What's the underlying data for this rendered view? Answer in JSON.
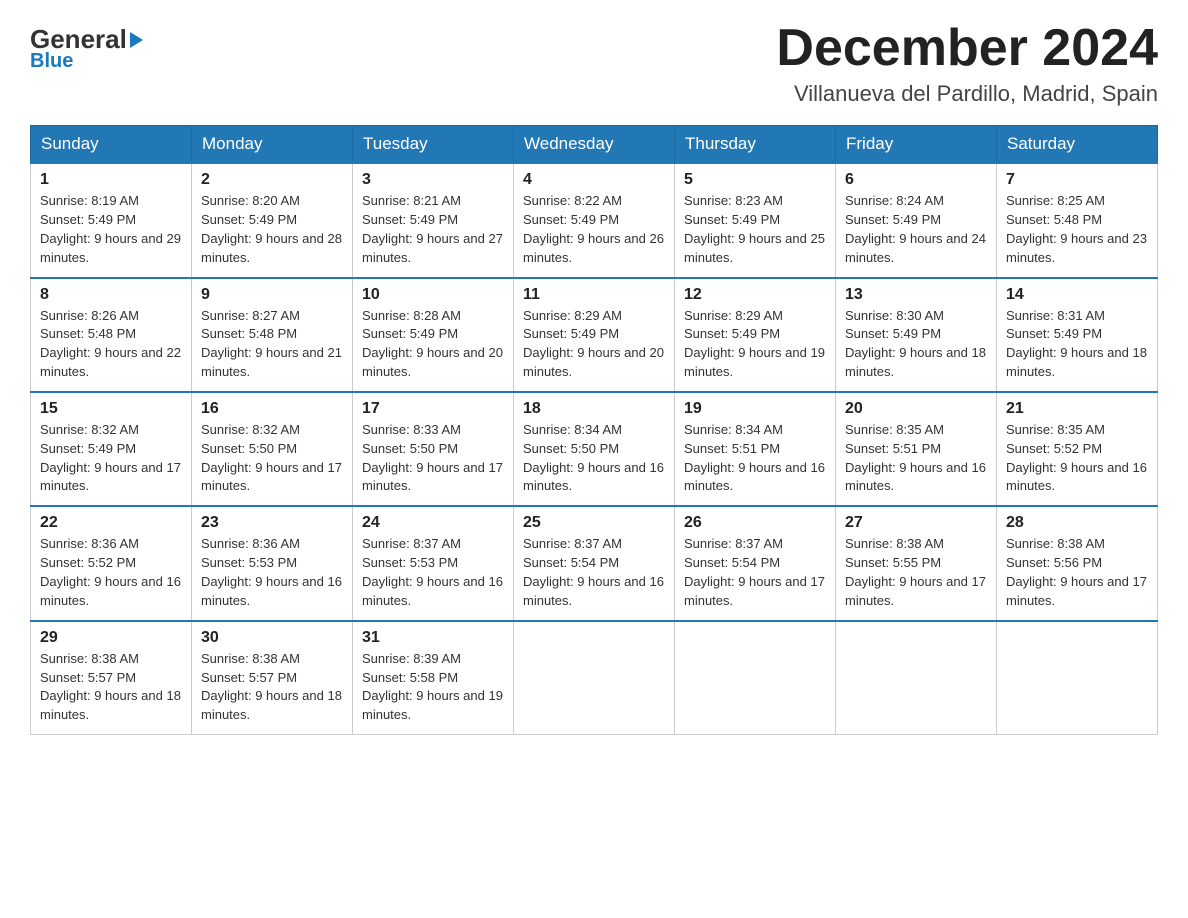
{
  "header": {
    "logo_general": "General",
    "logo_triangle": "▶",
    "logo_blue": "Blue",
    "month_title": "December 2024",
    "location": "Villanueva del Pardillo, Madrid, Spain"
  },
  "weekdays": [
    "Sunday",
    "Monday",
    "Tuesday",
    "Wednesday",
    "Thursday",
    "Friday",
    "Saturday"
  ],
  "weeks": [
    [
      {
        "day": "1",
        "sunrise": "8:19 AM",
        "sunset": "5:49 PM",
        "daylight": "9 hours and 29 minutes."
      },
      {
        "day": "2",
        "sunrise": "8:20 AM",
        "sunset": "5:49 PM",
        "daylight": "9 hours and 28 minutes."
      },
      {
        "day": "3",
        "sunrise": "8:21 AM",
        "sunset": "5:49 PM",
        "daylight": "9 hours and 27 minutes."
      },
      {
        "day": "4",
        "sunrise": "8:22 AM",
        "sunset": "5:49 PM",
        "daylight": "9 hours and 26 minutes."
      },
      {
        "day": "5",
        "sunrise": "8:23 AM",
        "sunset": "5:49 PM",
        "daylight": "9 hours and 25 minutes."
      },
      {
        "day": "6",
        "sunrise": "8:24 AM",
        "sunset": "5:49 PM",
        "daylight": "9 hours and 24 minutes."
      },
      {
        "day": "7",
        "sunrise": "8:25 AM",
        "sunset": "5:48 PM",
        "daylight": "9 hours and 23 minutes."
      }
    ],
    [
      {
        "day": "8",
        "sunrise": "8:26 AM",
        "sunset": "5:48 PM",
        "daylight": "9 hours and 22 minutes."
      },
      {
        "day": "9",
        "sunrise": "8:27 AM",
        "sunset": "5:48 PM",
        "daylight": "9 hours and 21 minutes."
      },
      {
        "day": "10",
        "sunrise": "8:28 AM",
        "sunset": "5:49 PM",
        "daylight": "9 hours and 20 minutes."
      },
      {
        "day": "11",
        "sunrise": "8:29 AM",
        "sunset": "5:49 PM",
        "daylight": "9 hours and 20 minutes."
      },
      {
        "day": "12",
        "sunrise": "8:29 AM",
        "sunset": "5:49 PM",
        "daylight": "9 hours and 19 minutes."
      },
      {
        "day": "13",
        "sunrise": "8:30 AM",
        "sunset": "5:49 PM",
        "daylight": "9 hours and 18 minutes."
      },
      {
        "day": "14",
        "sunrise": "8:31 AM",
        "sunset": "5:49 PM",
        "daylight": "9 hours and 18 minutes."
      }
    ],
    [
      {
        "day": "15",
        "sunrise": "8:32 AM",
        "sunset": "5:49 PM",
        "daylight": "9 hours and 17 minutes."
      },
      {
        "day": "16",
        "sunrise": "8:32 AM",
        "sunset": "5:50 PM",
        "daylight": "9 hours and 17 minutes."
      },
      {
        "day": "17",
        "sunrise": "8:33 AM",
        "sunset": "5:50 PM",
        "daylight": "9 hours and 17 minutes."
      },
      {
        "day": "18",
        "sunrise": "8:34 AM",
        "sunset": "5:50 PM",
        "daylight": "9 hours and 16 minutes."
      },
      {
        "day": "19",
        "sunrise": "8:34 AM",
        "sunset": "5:51 PM",
        "daylight": "9 hours and 16 minutes."
      },
      {
        "day": "20",
        "sunrise": "8:35 AM",
        "sunset": "5:51 PM",
        "daylight": "9 hours and 16 minutes."
      },
      {
        "day": "21",
        "sunrise": "8:35 AM",
        "sunset": "5:52 PM",
        "daylight": "9 hours and 16 minutes."
      }
    ],
    [
      {
        "day": "22",
        "sunrise": "8:36 AM",
        "sunset": "5:52 PM",
        "daylight": "9 hours and 16 minutes."
      },
      {
        "day": "23",
        "sunrise": "8:36 AM",
        "sunset": "5:53 PM",
        "daylight": "9 hours and 16 minutes."
      },
      {
        "day": "24",
        "sunrise": "8:37 AM",
        "sunset": "5:53 PM",
        "daylight": "9 hours and 16 minutes."
      },
      {
        "day": "25",
        "sunrise": "8:37 AM",
        "sunset": "5:54 PM",
        "daylight": "9 hours and 16 minutes."
      },
      {
        "day": "26",
        "sunrise": "8:37 AM",
        "sunset": "5:54 PM",
        "daylight": "9 hours and 17 minutes."
      },
      {
        "day": "27",
        "sunrise": "8:38 AM",
        "sunset": "5:55 PM",
        "daylight": "9 hours and 17 minutes."
      },
      {
        "day": "28",
        "sunrise": "8:38 AM",
        "sunset": "5:56 PM",
        "daylight": "9 hours and 17 minutes."
      }
    ],
    [
      {
        "day": "29",
        "sunrise": "8:38 AM",
        "sunset": "5:57 PM",
        "daylight": "9 hours and 18 minutes."
      },
      {
        "day": "30",
        "sunrise": "8:38 AM",
        "sunset": "5:57 PM",
        "daylight": "9 hours and 18 minutes."
      },
      {
        "day": "31",
        "sunrise": "8:39 AM",
        "sunset": "5:58 PM",
        "daylight": "9 hours and 19 minutes."
      },
      null,
      null,
      null,
      null
    ]
  ]
}
